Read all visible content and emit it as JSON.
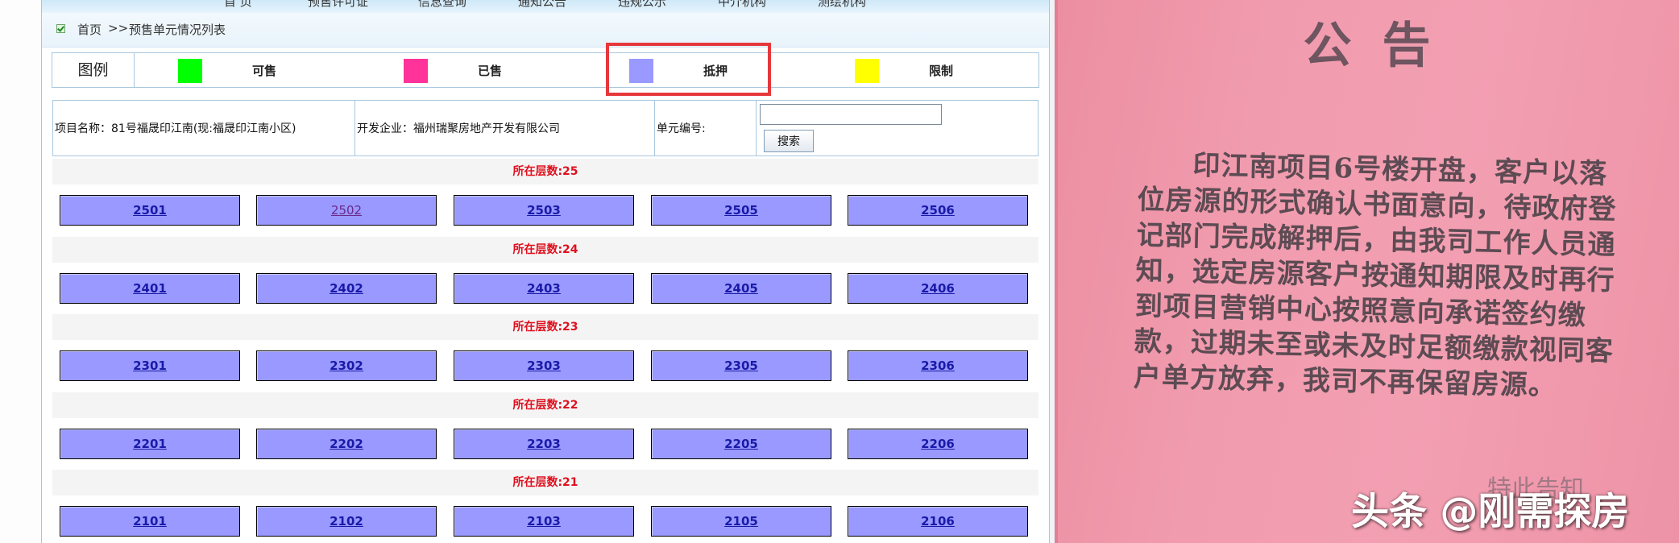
{
  "nav": {
    "items": [
      "首 页",
      "预售许可证",
      "信息查询",
      "通知公告",
      "违规公示",
      "中介机构",
      "测绘机构"
    ]
  },
  "breadcrumb": {
    "home": "首页",
    "separator": ">>",
    "current": "预售单元情况列表"
  },
  "legend": {
    "title": "图例",
    "items": [
      {
        "label": "可售",
        "color": "#00ff00"
      },
      {
        "label": "已售",
        "color": "#ff3399"
      },
      {
        "label": "抵押",
        "color": "#9999ff"
      },
      {
        "label": "限制",
        "color": "#ffff00"
      }
    ]
  },
  "info": {
    "project": "项目名称：81号福晟印江南(现:福晟印江南小区)",
    "developer": "开发企业：福州瑞聚房地产开发有限公司",
    "unit_label": "单元编号:",
    "unit_value": "",
    "search_label": "搜索"
  },
  "floors": [
    {
      "label": "所在层数:25",
      "units": [
        "2501",
        "2502",
        "2503",
        "2505",
        "2506"
      ]
    },
    {
      "label": "所在层数:24",
      "units": [
        "2401",
        "2402",
        "2403",
        "2405",
        "2406"
      ]
    },
    {
      "label": "所在层数:23",
      "units": [
        "2301",
        "2302",
        "2303",
        "2305",
        "2306"
      ]
    },
    {
      "label": "所在层数:22",
      "units": [
        "2201",
        "2202",
        "2203",
        "2205",
        "2206"
      ]
    },
    {
      "label": "所在层数:21",
      "units": [
        "2101",
        "2102",
        "2103",
        "2105",
        "2106"
      ]
    }
  ],
  "colors": {
    "unit_mortgaged": "#9999ff",
    "floor_label": "#e0101e",
    "highlight": "#e5383b",
    "notice_paper": "#f19bae"
  },
  "notice": {
    "title": "公告",
    "body": "印江南项目6号楼开盘，客户以落位房源的形式确认书面意向，待政府登记部门完成解押后，由我司工作人员通知，选定房源客户按通知期限及时再行到项目营销中心按照意向承诺签约缴款，过期未至或未及时足额缴款视同客户单方放弃，我司不再保留房源。",
    "signature": "特此告知",
    "watermark": "头条 @刚需探房"
  }
}
